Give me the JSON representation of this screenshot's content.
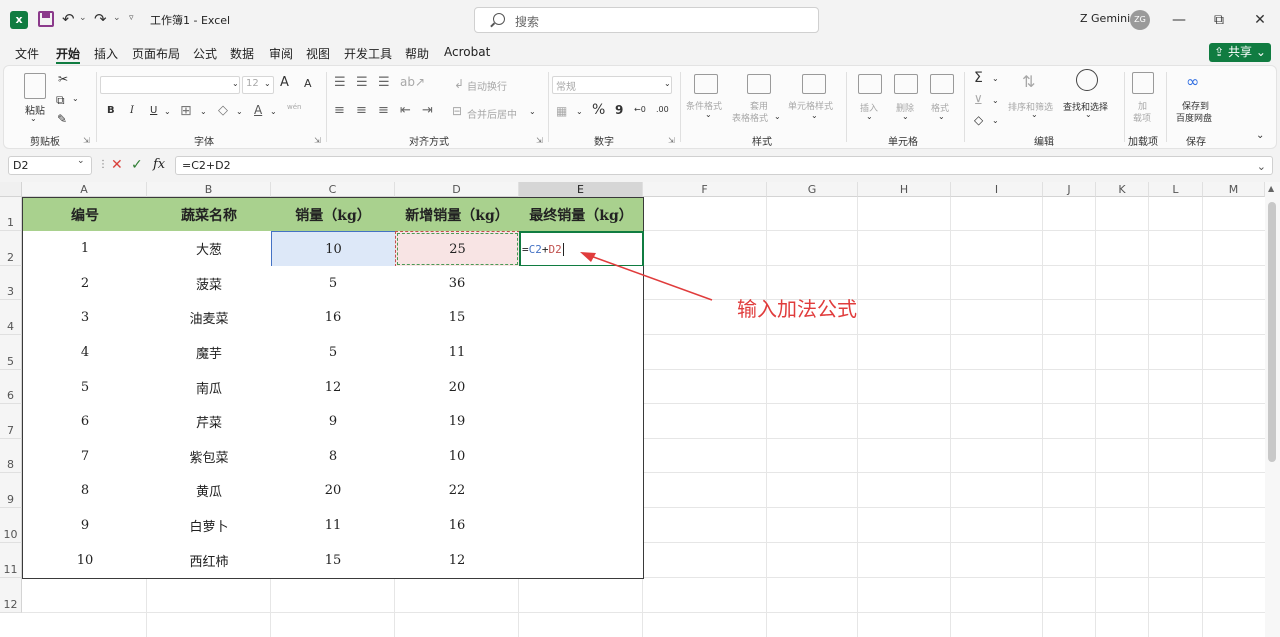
{
  "titlebar": {
    "doc_title": "工作簿1 - Excel",
    "search_placeholder": "搜索",
    "user_name": "Z Gemini",
    "avatar_initials": "ZG",
    "app_logo": "x",
    "undo_glyph": "↶",
    "redo_glyph": "↷",
    "customize_glyph": "▿",
    "minimize_glyph": "—",
    "restore_glyph": "⧉",
    "close_glyph": "✕"
  },
  "menu": {
    "items": [
      "文件",
      "开始",
      "插入",
      "页面布局",
      "公式",
      "数据",
      "审阅",
      "视图",
      "开发工具",
      "帮助",
      "Acrobat"
    ],
    "active": "开始",
    "share_label": "共享"
  },
  "ribbon": {
    "clipboard": {
      "paste": "粘贴",
      "label": "剪贴板"
    },
    "font": {
      "size": "12",
      "grow": "A",
      "shrink": "A",
      "bold": "B",
      "italic": "I",
      "underline": "U",
      "font_color_glyph": "A",
      "phonetic": "wén",
      "label": "字体"
    },
    "alignment": {
      "wrap": "自动换行",
      "merge": "合并后居中",
      "label": "对齐方式"
    },
    "number": {
      "format": "常规",
      "percent": "%",
      "comma": "9",
      "inc_decimal": "←0",
      "dec_decimal": ".00",
      "label": "数字"
    },
    "styles": {
      "conditional": "条件格式",
      "table_line1": "套用",
      "table_line2": "表格格式",
      "cell_styles": "单元格样式",
      "label": "样式"
    },
    "cells": {
      "insert": "插入",
      "delete": "删除",
      "format": "格式",
      "label": "单元格"
    },
    "editing": {
      "sum_glyph": "Σ",
      "sort": "排序和筛选",
      "find": "查找和选择",
      "label": "编辑"
    },
    "addins": {
      "line1": "加",
      "line2": "载项",
      "label": "加载项"
    },
    "save": {
      "line1": "保存到",
      "line2": "百度网盘",
      "label": "保存"
    }
  },
  "formula_bar": {
    "name_box": "D2",
    "formula": "=C2+D2",
    "fx": "fx",
    "cancel_glyph": "✕",
    "confirm_glyph": "✓"
  },
  "grid": {
    "columns": [
      "A",
      "B",
      "C",
      "D",
      "E",
      "F",
      "G",
      "H",
      "I",
      "J",
      "K",
      "L",
      "M"
    ],
    "rows": [
      "1",
      "2",
      "3",
      "4",
      "5",
      "6",
      "7",
      "8",
      "9",
      "10",
      "11",
      "12"
    ],
    "headers": [
      "编号",
      "蔬菜名称",
      "销量（kg）",
      "新增销量（kg）",
      "最终销量（kg）"
    ],
    "data": [
      [
        "1",
        "大葱",
        "10",
        "25"
      ],
      [
        "2",
        "菠菜",
        "5",
        "36"
      ],
      [
        "3",
        "油麦菜",
        "16",
        "15"
      ],
      [
        "4",
        "魔芋",
        "5",
        "11"
      ],
      [
        "5",
        "南瓜",
        "12",
        "20"
      ],
      [
        "6",
        "芹菜",
        "9",
        "19"
      ],
      [
        "7",
        "紫包菜",
        "8",
        "10"
      ],
      [
        "8",
        "黄瓜",
        "20",
        "22"
      ],
      [
        "9",
        "白萝卜",
        "11",
        "16"
      ],
      [
        "10",
        "西红柿",
        "15",
        "12"
      ]
    ],
    "editing_formula": {
      "eq": "=",
      "ref1": "C2",
      "op": "+",
      "ref2": "D2"
    }
  },
  "annotation": "输入加法公式",
  "colors": {
    "accent": "#107c41",
    "header_fill": "#a9d18e",
    "ref_blue": "#4472c4",
    "ref_red": "#c0504d",
    "annotation": "#e03c3c"
  }
}
